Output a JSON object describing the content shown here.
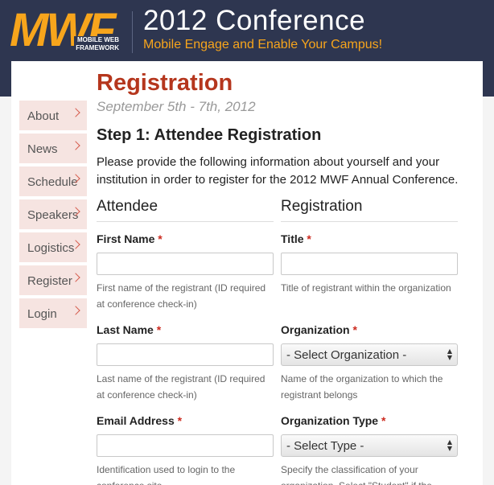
{
  "header": {
    "logo_text": "MWF",
    "logo_subtitle_line1": "MOBILE WEB",
    "logo_subtitle_line2": "FRAMEWORK",
    "title": "2012 Conference",
    "tagline": "Mobile Engage and Enable Your Campus!"
  },
  "colors": {
    "header_bg": "#2e3650",
    "accent_orange": "#f7a51c",
    "title_red": "#b5361d",
    "nav_bg": "#f6e4e1",
    "required_red": "#cc2a1f"
  },
  "nav": {
    "items": [
      {
        "label": "About",
        "icon": "chevron-right-icon"
      },
      {
        "label": "News",
        "icon": "chevron-right-icon"
      },
      {
        "label": "Schedule",
        "icon": "chevron-right-icon"
      },
      {
        "label": "Speakers",
        "icon": "chevron-right-icon"
      },
      {
        "label": "Logistics",
        "icon": "chevron-right-icon"
      },
      {
        "label": "Register",
        "icon": "chevron-right-icon"
      },
      {
        "label": "Login",
        "icon": "chevron-right-icon"
      }
    ]
  },
  "page": {
    "title": "Registration",
    "dates": "September 5th - 7th, 2012",
    "step_title": "Step 1: Attendee Registration",
    "intro": "Please provide the following information about yourself and your institution in order to register for the 2012 MWF Annual Conference."
  },
  "form": {
    "required_marker": "*",
    "attendee": {
      "heading": "Attendee",
      "first_name": {
        "label": "First Name",
        "value": "",
        "help": "First name of the registrant (ID required at conference check-in)"
      },
      "last_name": {
        "label": "Last Name",
        "value": "",
        "help": "Last name of the registrant (ID required at conference check-in)"
      },
      "email": {
        "label": "Email Address",
        "value": "",
        "help": "Identification used to login to the conference site"
      }
    },
    "registration": {
      "heading": "Registration",
      "title": {
        "label": "Title",
        "value": "",
        "help": "Title of registrant within the organization"
      },
      "organization": {
        "label": "Organization",
        "selected": "- Select Organization -",
        "help": "Name of the organization to which the registrant belongs"
      },
      "organization_type": {
        "label": "Organization Type",
        "selected": "- Select Type -",
        "help": "Specify the classification of your organization. Select \"Student\" if the"
      }
    }
  }
}
